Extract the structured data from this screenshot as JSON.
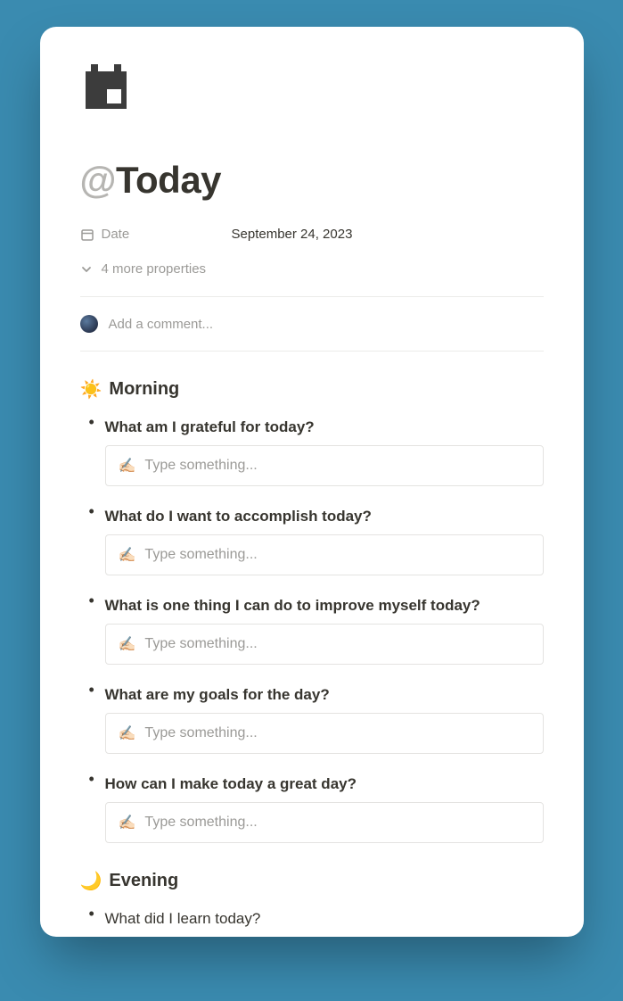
{
  "title_at": "@",
  "title_text": "Today",
  "meta": {
    "date_label": "Date",
    "date_value": "September 24, 2023",
    "more_properties": "4 more properties"
  },
  "comment_placeholder": "Add a comment...",
  "sections": {
    "morning": {
      "emoji": "☀️",
      "title": "Morning",
      "prompts": [
        "What am I grateful for today?",
        "What do I want to accomplish today?",
        "What is one thing I can do to improve myself today?",
        "What are my goals for the day?",
        "How can I make today a great day?"
      ]
    },
    "evening": {
      "emoji": "🌙",
      "title": "Evening",
      "prompts": [
        "What did I learn today?"
      ]
    }
  },
  "input_placeholder": "Type something...",
  "input_emoji": "✍🏻"
}
